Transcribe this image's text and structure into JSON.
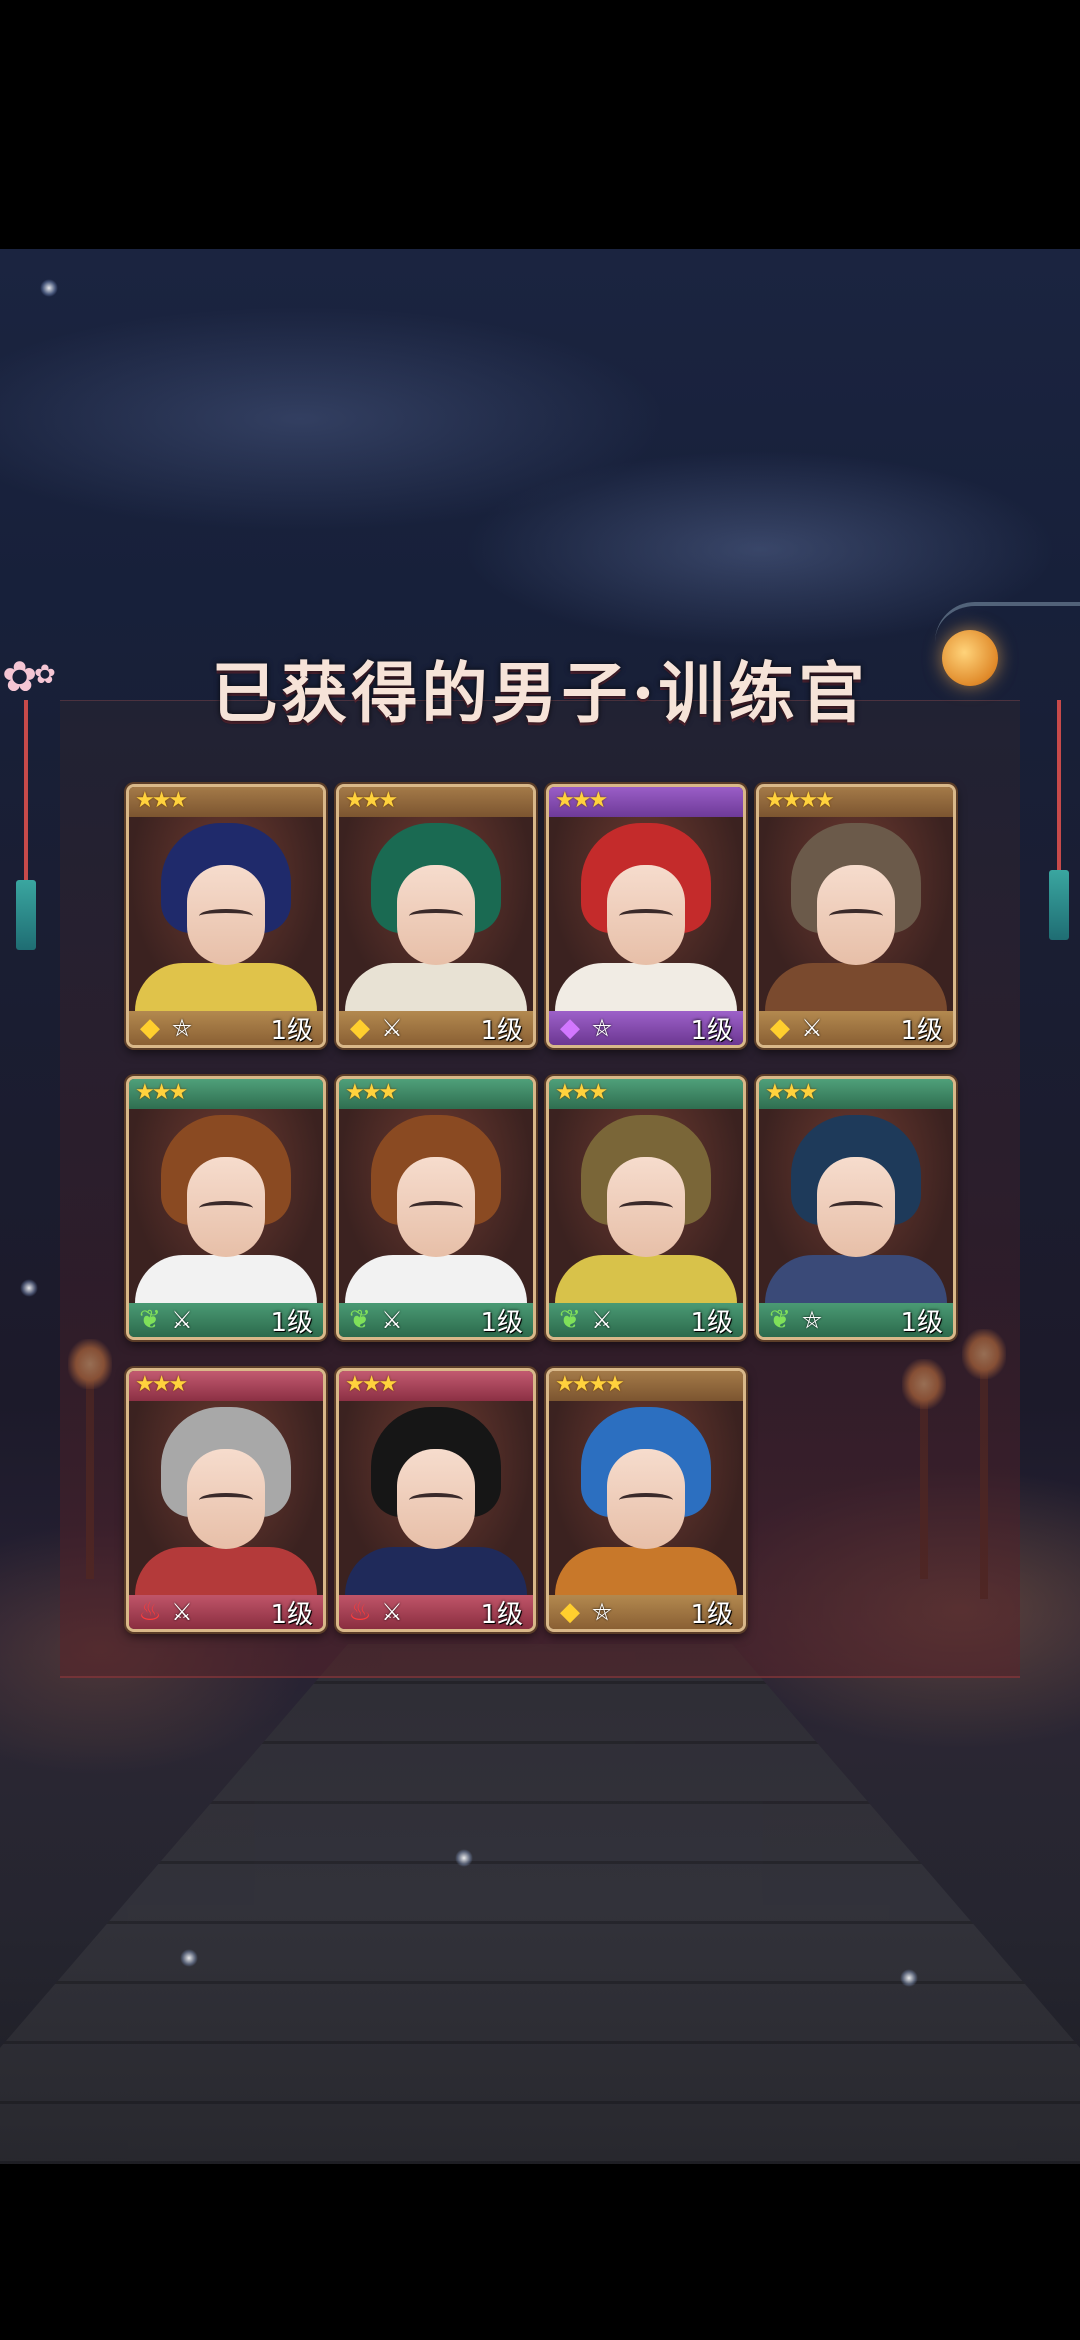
{
  "title": "已获得的男子·训练官",
  "colors": {
    "gold": "#b8905a",
    "purple": "#8a4fb0",
    "green": "#3f8f6a",
    "red": "#b4485a"
  },
  "cards": [
    {
      "stars": "★★★",
      "frame": "gold",
      "element_icon": "gold-gem-icon",
      "element_glyph": "◆",
      "class_icon": "pentagram-icon",
      "class_glyph": "⛤",
      "level": "1级",
      "hair": "#1f2a6b",
      "shoulders": "#e0c34a"
    },
    {
      "stars": "★★★",
      "frame": "gold",
      "element_icon": "gold-gem-icon",
      "element_glyph": "◆",
      "class_icon": "crossed-swords-icon",
      "class_glyph": "⚔",
      "level": "1级",
      "hair": "#1a6a52",
      "shoulders": "#e8e2d4"
    },
    {
      "stars": "★★★",
      "frame": "purple",
      "element_icon": "purple-gem-icon",
      "element_glyph": "◆",
      "class_icon": "pentagram-icon",
      "class_glyph": "⛤",
      "level": "1级",
      "hair": "#c42b2b",
      "shoulders": "#f1ece4"
    },
    {
      "stars": "★★★★",
      "frame": "gold",
      "element_icon": "gold-gem-icon",
      "element_glyph": "◆",
      "class_icon": "crossed-swords-icon",
      "class_glyph": "⚔",
      "level": "1级",
      "hair": "#6b5a4a",
      "shoulders": "#7a4a2e"
    },
    {
      "stars": "★★★",
      "frame": "green",
      "element_icon": "leaf-icon",
      "element_glyph": "❦",
      "class_icon": "crossed-swords-icon",
      "class_glyph": "⚔",
      "level": "1级",
      "hair": "#8a4a22",
      "shoulders": "#f2f2f2"
    },
    {
      "stars": "★★★",
      "frame": "green",
      "element_icon": "leaf-icon",
      "element_glyph": "❦",
      "class_icon": "crossed-swords-icon",
      "class_glyph": "⚔",
      "level": "1级",
      "hair": "#8a4a22",
      "shoulders": "#f2f2f2"
    },
    {
      "stars": "★★★",
      "frame": "green",
      "element_icon": "leaf-icon",
      "element_glyph": "❦",
      "class_icon": "crossed-swords-icon",
      "class_glyph": "⚔",
      "level": "1级",
      "hair": "#7a6638",
      "shoulders": "#d8c24a"
    },
    {
      "stars": "★★★",
      "frame": "green",
      "element_icon": "leaf-icon",
      "element_glyph": "❦",
      "class_icon": "pentagram-icon",
      "class_glyph": "⛤",
      "level": "1级",
      "hair": "#1e3a5a",
      "shoulders": "#3a4a78"
    },
    {
      "stars": "★★★",
      "frame": "red",
      "element_icon": "fire-icon",
      "element_glyph": "♨",
      "class_icon": "crossed-swords-icon",
      "class_glyph": "⚔",
      "level": "1级",
      "hair": "#a8a8a8",
      "shoulders": "#b43a3a"
    },
    {
      "stars": "★★★",
      "frame": "red",
      "element_icon": "fire-icon",
      "element_glyph": "♨",
      "class_icon": "crossed-swords-icon",
      "class_glyph": "⚔",
      "level": "1级",
      "hair": "#161616",
      "shoulders": "#1f2a5a"
    },
    {
      "stars": "★★★★",
      "frame": "gold",
      "element_icon": "gold-gem-icon",
      "element_glyph": "◆",
      "class_icon": "pentagram-icon",
      "class_glyph": "⛤",
      "level": "1级",
      "hair": "#2c6fc0",
      "shoulders": "#c8782a"
    }
  ]
}
